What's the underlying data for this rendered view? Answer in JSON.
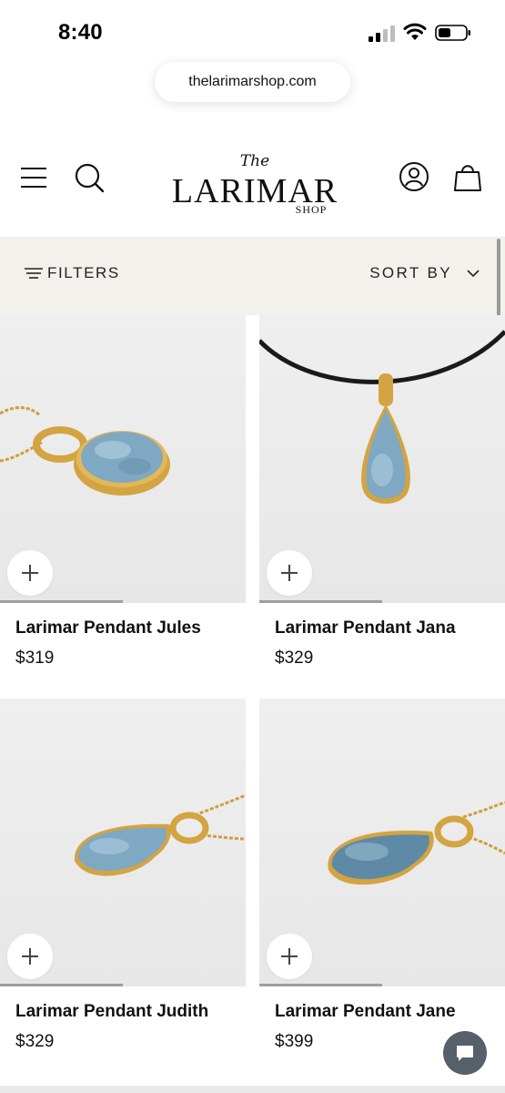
{
  "status_bar": {
    "time": "8:40"
  },
  "browser": {
    "url": "thelarimarshop.com"
  },
  "header": {
    "logo": {
      "top": "The",
      "main": "LARIMAR",
      "sub": "SHOP"
    }
  },
  "filter_bar": {
    "filters_label": "FILTERS",
    "sort_label": "SORT BY"
  },
  "products": [
    {
      "name": "Larimar Pendant Jules",
      "price": "$319",
      "image_progress": 0.5
    },
    {
      "name": "Larimar Pendant Jana",
      "price": "$329",
      "image_progress": 0.5
    },
    {
      "name": "Larimar Pendant Judith",
      "price": "$329",
      "image_progress": 0.5
    },
    {
      "name": "Larimar Pendant Jane",
      "price": "$399",
      "image_progress": 0.5
    }
  ],
  "colors": {
    "filter_bar_bg": "#f3f1ec",
    "chat_button": "#55606b",
    "gold": "#d3a441",
    "stone": "#7fa8c2"
  }
}
